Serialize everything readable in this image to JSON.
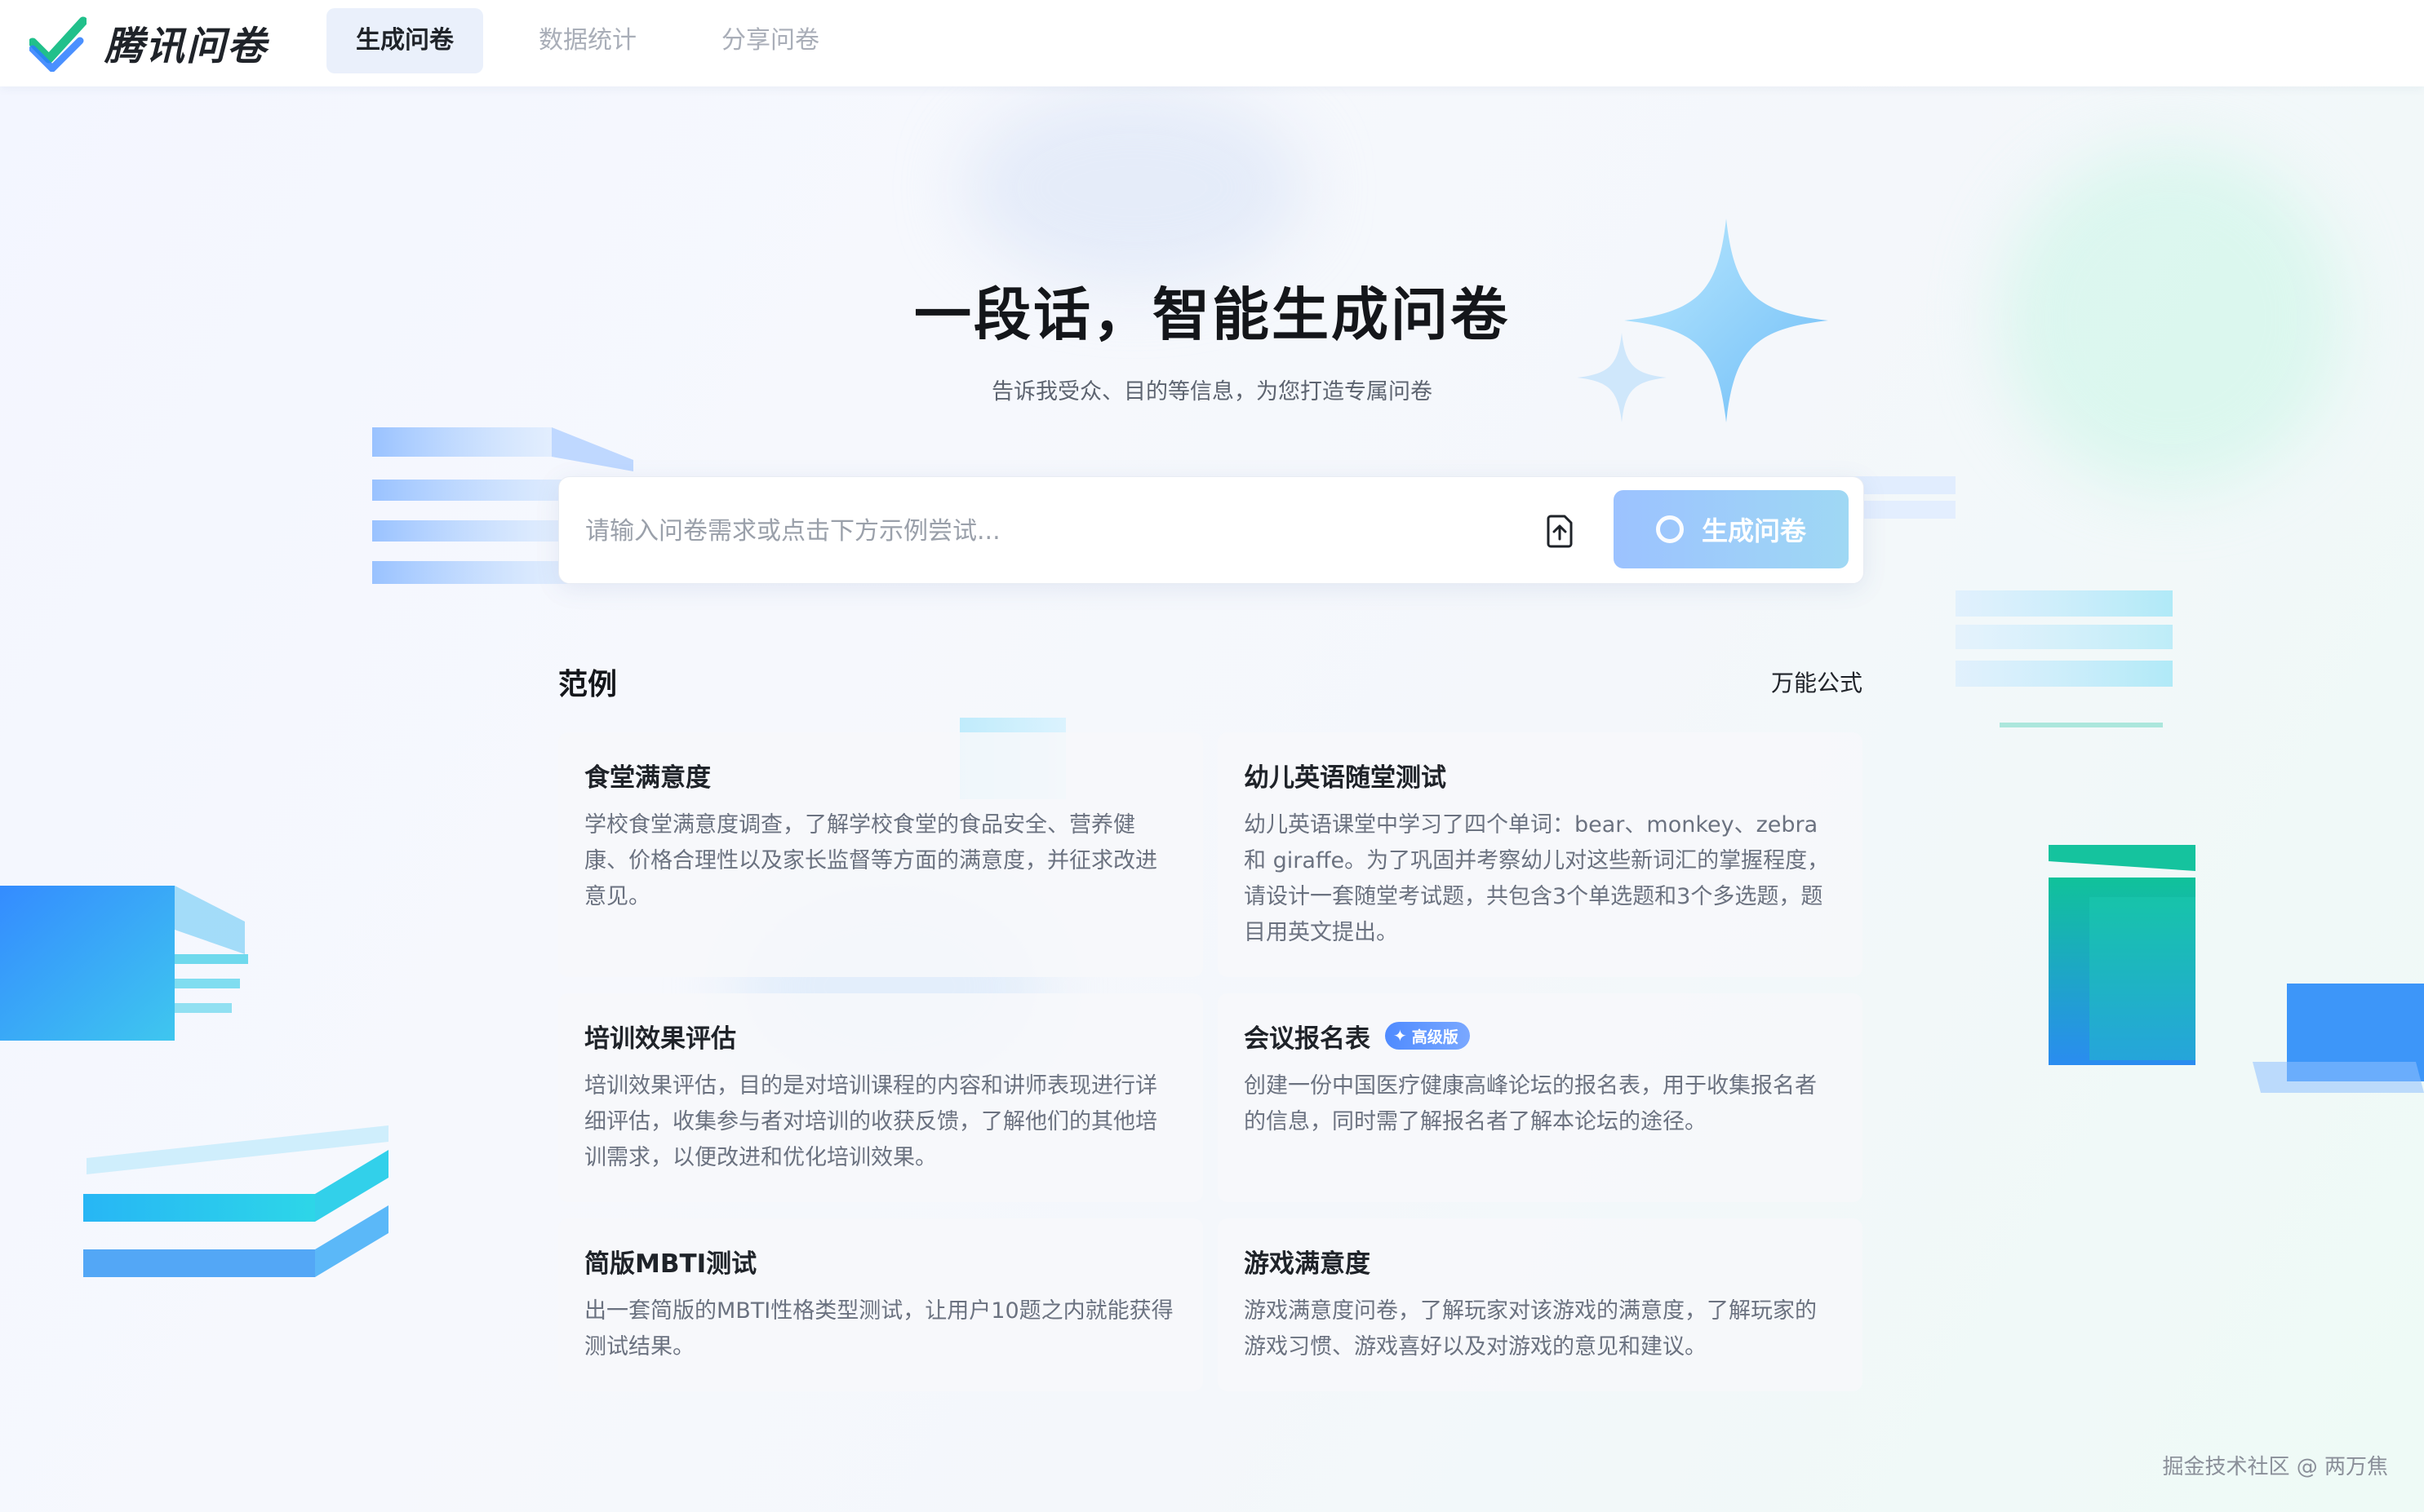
{
  "header": {
    "logo_text": "腾讯问卷",
    "tabs": [
      {
        "label": "生成问卷",
        "active": true
      },
      {
        "label": "数据统计",
        "active": false
      },
      {
        "label": "分享问卷",
        "active": false
      }
    ]
  },
  "hero": {
    "title": "一段话，智能生成问卷",
    "subtitle": "告诉我受众、目的等信息，为您打造专属问卷"
  },
  "prompt": {
    "placeholder": "请输入问卷需求或点击下方示例尝试...",
    "value": "",
    "upload_icon": "upload-icon",
    "generate_label": "生成问卷"
  },
  "examples": {
    "title": "范例",
    "formula_label": "万能公式",
    "cards": [
      {
        "title": "食堂满意度",
        "desc": "学校食堂满意度调查，了解学校食堂的食品安全、营养健康、价格合理性以及家长监督等方面的满意度，并征求改进意见。"
      },
      {
        "title": "幼儿英语随堂测试",
        "desc": "幼儿英语课堂中学习了四个单词：bear、monkey、zebra 和 giraffe。为了巩固并考察幼儿对这些新词汇的掌握程度，请设计一套随堂考试题，共包含3个单选题和3个多选题，题目用英文提出。"
      },
      {
        "title": "培训效果评估",
        "desc": "培训效果评估，目的是对培训课程的内容和讲师表现进行详细评估，收集参与者对培训的收获反馈，了解他们的其他培训需求，以便改进和优化培训效果。"
      },
      {
        "title": "会议报名表",
        "badge": "高级版",
        "desc": "创建一份中国医疗健康高峰论坛的报名表，用于收集报名者的信息，同时需了解报名者了解本论坛的途径。"
      },
      {
        "title": "简版MBTI测试",
        "desc": "出一套简版的MBTI性格类型测试，让用户10题之内就能获得测试结果。"
      },
      {
        "title": "游戏满意度",
        "desc": "游戏满意度问卷，了解玩家对该游戏的满意度，了解玩家的游戏习惯、游戏喜好以及对游戏的意见和建议。"
      }
    ]
  },
  "watermark": "掘金技术社区 @ 两万焦",
  "colors": {
    "accent": "#4f8bff",
    "generate_button": "#9cc2ff",
    "logo_green": "#21c08b",
    "logo_blue": "#2a7dff"
  }
}
